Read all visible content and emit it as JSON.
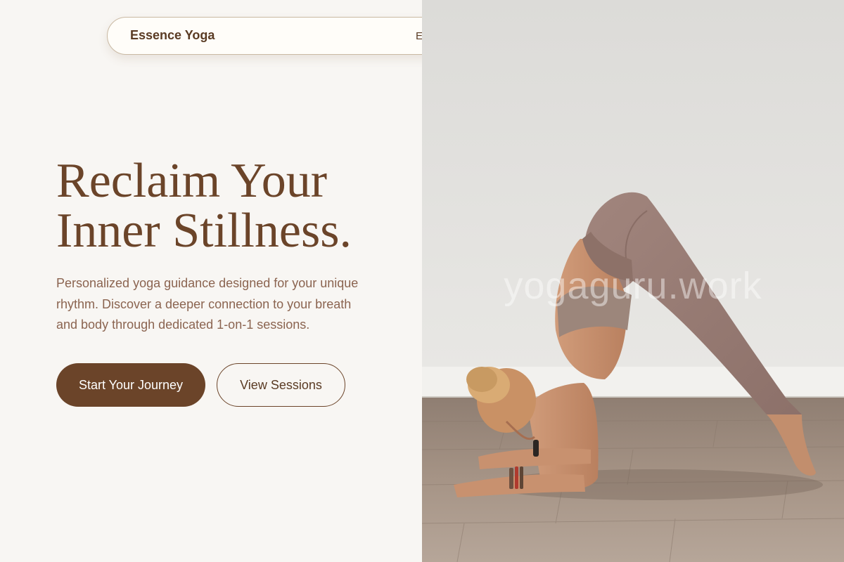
{
  "nav": {
    "brand": "Essence Yoga",
    "link_partial": "E"
  },
  "hero": {
    "headline_line1": "Reclaim Your",
    "headline_line2": "Inner Stillness.",
    "subtext": "Personalized yoga guidance designed for your unique rhythm. Discover a deeper connection to your breath and body through dedicated 1-on-1 sessions.",
    "primary_cta": "Start Your Journey",
    "secondary_cta": "View Sessions"
  },
  "photo": {
    "watermark": "yogaguru.work"
  },
  "colors": {
    "background": "#f8f6f3",
    "brand_brown": "#6b4429",
    "text_muted": "#8b6450",
    "pill_border": "#c9b9a3"
  }
}
